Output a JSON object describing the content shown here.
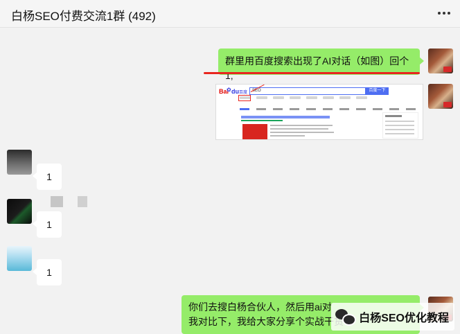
{
  "header": {
    "title": "白杨SEO付费交流1群 (492)"
  },
  "messages": {
    "m1": {
      "text": "群里用百度搜索出现了AI对话（如图）回个1,"
    },
    "m2": {
      "screenshot": {
        "logo_left": "Bai",
        "logo_right": "du",
        "logo_sub": "百度",
        "query": "SEO",
        "button": "百度一下"
      }
    },
    "m3": {
      "text": "1"
    },
    "m4": {
      "text": "1"
    },
    "m5": {
      "text": "1"
    },
    "m6": {
      "line1": "你们去搜白杨合伙人，然后用ai对",
      "line2": "我对比下，我给大家分享个实战干货"
    }
  },
  "watermark": {
    "text": "白杨SEO优化教程"
  },
  "colors": {
    "self_bubble": "#95ec69",
    "other_bubble": "#ffffff",
    "highlight": "#e8261f"
  }
}
